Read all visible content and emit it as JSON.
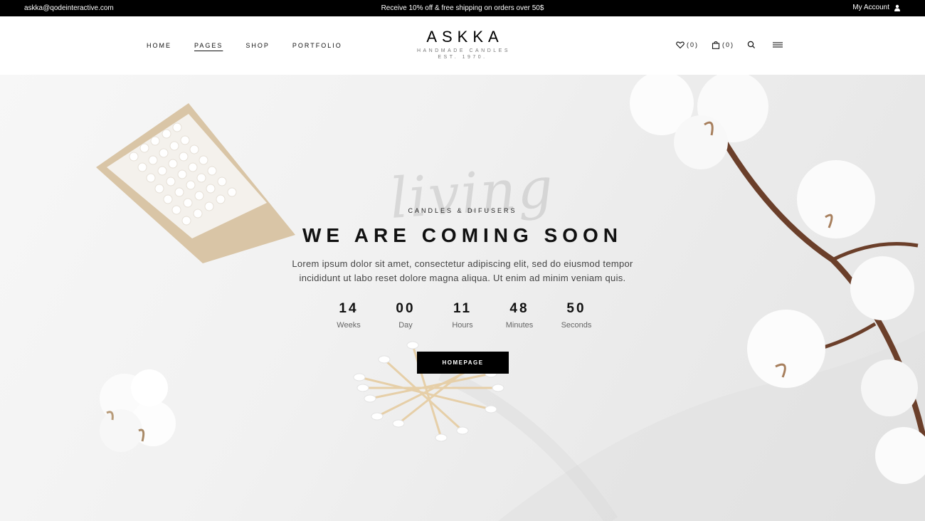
{
  "topbar": {
    "email": "askka@qodeinteractive.com",
    "promo": "Receive 10% off & free shipping on orders over 50$",
    "account": "My Account"
  },
  "nav": {
    "items": [
      {
        "label": "HOME"
      },
      {
        "label": "PAGES"
      },
      {
        "label": "SHOP"
      },
      {
        "label": "PORTFOLIO"
      }
    ]
  },
  "logo": {
    "brand": "ASKKA",
    "tagline": "HANDMADE CANDLES",
    "est": "EST. 1970."
  },
  "tools": {
    "wishlist_count": "(0)",
    "cart_count": "(0)"
  },
  "hero": {
    "script_text": "living",
    "eyebrow": "CANDLES & DIFUSERS",
    "title": "WE ARE COMING SOON",
    "desc_line1": "Lorem ipsum dolor sit amet, consectetur adipiscing elit, sed do eiusmod tempor",
    "desc_line2": "incididunt ut labo reset dolore magna aliqua. Ut enim ad minim veniam quis.",
    "countdown": [
      {
        "value": "14",
        "label": "Weeks"
      },
      {
        "value": "00",
        "label": "Day"
      },
      {
        "value": "11",
        "label": "Hours"
      },
      {
        "value": "48",
        "label": "Minutes"
      },
      {
        "value": "50",
        "label": "Seconds"
      }
    ],
    "button": "HOMEPAGE"
  },
  "icons": [
    "user-icon",
    "heart-icon",
    "bag-icon",
    "search-icon",
    "menu-icon"
  ]
}
